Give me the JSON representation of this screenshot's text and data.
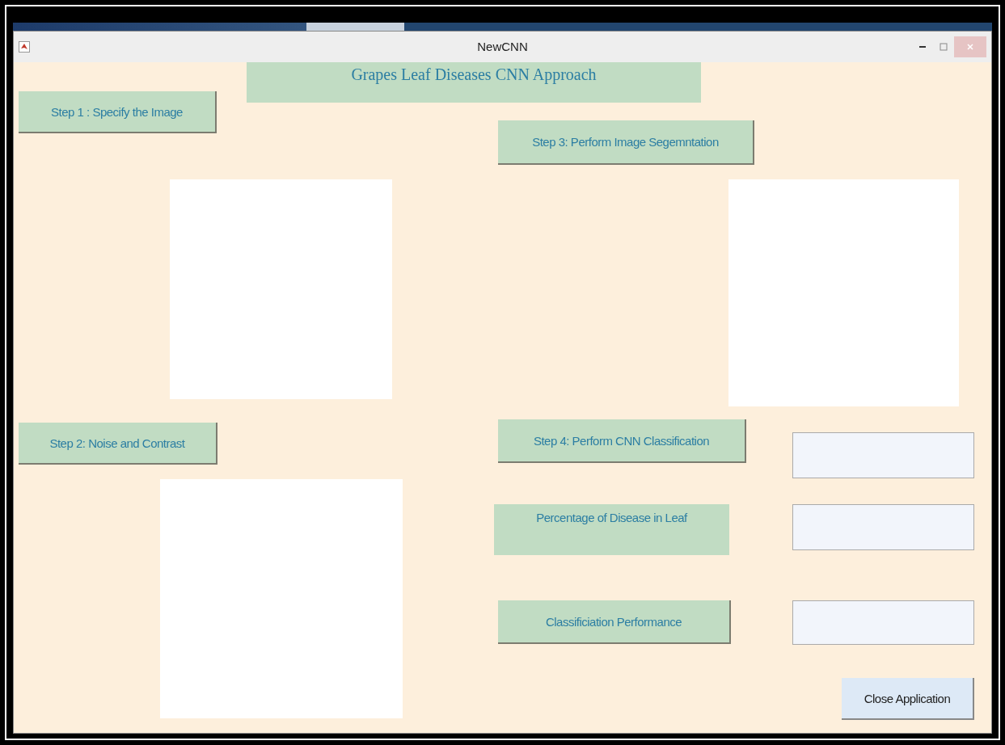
{
  "window": {
    "title": "NewCNN"
  },
  "heading": "Grapes Leaf Diseases CNN Approach",
  "controls": [
    {
      "kind": "button",
      "label": "Step 1 : Specify the Image"
    },
    {
      "kind": "button",
      "label": "Step 3: Perform Image Segemntation"
    },
    {
      "kind": "axes"
    },
    {
      "kind": "axes"
    },
    {
      "kind": "button",
      "label": "Step 2: Noise and Contrast"
    },
    {
      "kind": "button",
      "label": "Step 4: Perform CNN Classification"
    },
    {
      "kind": "field"
    },
    {
      "kind": "label",
      "label": "Percentage of Disease in Leaf"
    },
    {
      "kind": "field"
    },
    {
      "kind": "axes"
    },
    {
      "kind": "button",
      "label": "Classificiation Performance"
    },
    {
      "kind": "field"
    },
    {
      "kind": "system_button",
      "label": "Close Application"
    }
  ]
}
